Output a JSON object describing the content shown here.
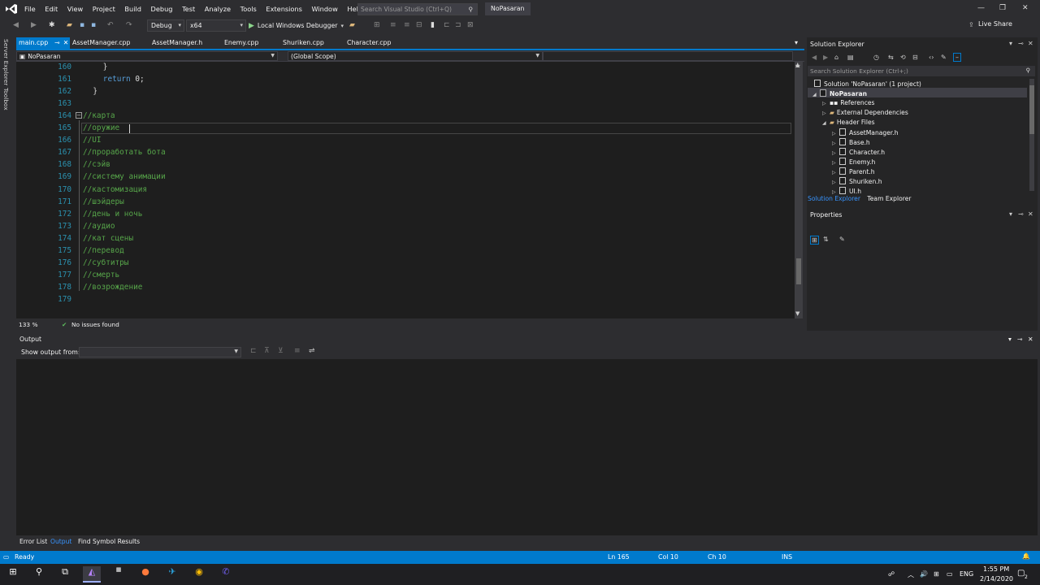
{
  "menu": [
    "File",
    "Edit",
    "View",
    "Project",
    "Build",
    "Debug",
    "Test",
    "Analyze",
    "Tools",
    "Extensions",
    "Window",
    "Help"
  ],
  "search_placeholder": "Search Visual Studio (Ctrl+Q)",
  "project_name": "NoPasaran",
  "toolbar": {
    "config": "Debug",
    "platform": "x64",
    "debugger": "Local Windows Debugger",
    "live_share": "Live Share"
  },
  "left_tabs": [
    "Server Explorer",
    "Toolbox"
  ],
  "doc_tabs": [
    "main.cpp",
    "AssetManager.cpp",
    "AssetManager.h",
    "Enemy.cpp",
    "Shuriken.cpp",
    "Character.cpp"
  ],
  "nav": {
    "project": "NoPasaran",
    "scope": "(Global Scope)"
  },
  "code_lines": [
    {
      "n": "160",
      "t": "}",
      "c": "tx",
      "i": "        "
    },
    {
      "n": "161",
      "t": "return 0;",
      "c": "kw",
      "i": "        "
    },
    {
      "n": "162",
      "t": "}",
      "c": "tx",
      "i": "    "
    },
    {
      "n": "163",
      "t": "",
      "c": "tx",
      "i": ""
    },
    {
      "n": "164",
      "t": "//карта",
      "c": "cm",
      "i": ""
    },
    {
      "n": "165",
      "t": "//оружие",
      "c": "cm",
      "i": ""
    },
    {
      "n": "166",
      "t": "//UI",
      "c": "cm",
      "i": ""
    },
    {
      "n": "167",
      "t": "//проработать бота",
      "c": "cm",
      "i": ""
    },
    {
      "n": "168",
      "t": "//сэйв",
      "c": "cm",
      "i": ""
    },
    {
      "n": "169",
      "t": "//систему анимации",
      "c": "cm",
      "i": ""
    },
    {
      "n": "170",
      "t": "//кастомизация",
      "c": "cm",
      "i": ""
    },
    {
      "n": "171",
      "t": "//шэйдеры",
      "c": "cm",
      "i": ""
    },
    {
      "n": "172",
      "t": "//день и ночь",
      "c": "cm",
      "i": ""
    },
    {
      "n": "173",
      "t": "//аудио",
      "c": "cm",
      "i": ""
    },
    {
      "n": "174",
      "t": "//кат сцены",
      "c": "cm",
      "i": ""
    },
    {
      "n": "175",
      "t": "//перевод",
      "c": "cm",
      "i": ""
    },
    {
      "n": "176",
      "t": "//субтитры",
      "c": "cm",
      "i": ""
    },
    {
      "n": "177",
      "t": "//смерть",
      "c": "cm",
      "i": ""
    },
    {
      "n": "178",
      "t": "//возрождение",
      "c": "cm",
      "i": ""
    },
    {
      "n": "179",
      "t": "",
      "c": "tx",
      "i": ""
    }
  ],
  "editor_status": {
    "zoom": "133 %",
    "issues": "No issues found"
  },
  "solution_explorer": {
    "title": "Solution Explorer",
    "search_placeholder": "Search Solution Explorer (Ctrl+;)",
    "solution": "Solution 'NoPasaran' (1 project)",
    "project": "NoPasaran",
    "nodes": [
      "References",
      "External Dependencies",
      "Header Files"
    ],
    "headers": [
      "AssetManager.h",
      "Base.h",
      "Character.h",
      "Enemy.h",
      "Parent.h",
      "Shuriken.h",
      "UI.h"
    ],
    "tabs": [
      "Solution Explorer",
      "Team Explorer"
    ]
  },
  "properties_title": "Properties",
  "output": {
    "title": "Output",
    "show_label": "Show output from:"
  },
  "bottom_tabs": [
    "Error List",
    "Output",
    "Find Symbol Results"
  ],
  "status": {
    "ready": "Ready",
    "ln": "Ln 165",
    "col": "Col 10",
    "ch": "Ch 10",
    "mode": "INS"
  },
  "taskbar": {
    "lang": "ENG",
    "time": "1:55 PM",
    "date": "2/14/2020",
    "notif_count": "2"
  },
  "colors": {
    "accent": "#007acc",
    "comment": "#57a64a",
    "keyword": "#569cd6",
    "line_number": "#2b91af"
  }
}
